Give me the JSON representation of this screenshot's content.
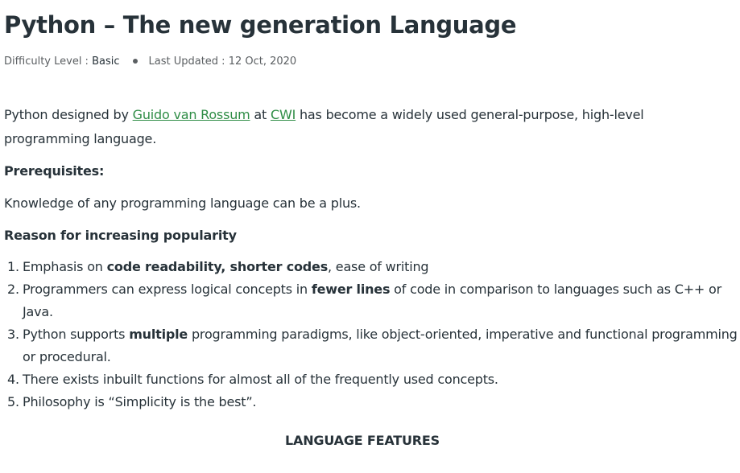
{
  "article": {
    "title": "Python – The new generation Language",
    "meta": {
      "difficulty_label": "Difficulty Level : ",
      "difficulty_value": "Basic",
      "updated_label": "Last Updated : 12 Oct, 2020"
    },
    "intro": {
      "prefix": "Python designed by ",
      "link1": "Guido van Rossum",
      "mid": " at ",
      "link2": "CWI",
      "suffix": " has become a widely used general-purpose, high-level programming language."
    },
    "prerequisites_heading": "Prerequisites:",
    "prerequisites_text": "Knowledge of any programming language can be a plus.",
    "reason_heading": "Reason for increasing popularity",
    "reasons": [
      {
        "pre": "Emphasis on ",
        "bold": "code readability, shorter codes",
        "post": ", ease of writing"
      },
      {
        "pre": "Programmers can express logical concepts in ",
        "bold": "fewer lines",
        "post": " of code in comparison to languages such as C++ or Java."
      },
      {
        "pre": "Python supports ",
        "bold": "multiple",
        "post": " programming paradigms, like object-oriented, imperative and functional programming or procedural."
      },
      {
        "pre": "There exists inbuilt functions for almost all of the frequently used concepts.",
        "bold": "",
        "post": ""
      },
      {
        "pre": "Philosophy is “Simplicity is the best”.",
        "bold": "",
        "post": ""
      }
    ],
    "features_heading": "LANGUAGE FEATURES"
  },
  "colors": {
    "text": "#273239",
    "muted": "#5b5f62",
    "link": "#2f8d46"
  }
}
